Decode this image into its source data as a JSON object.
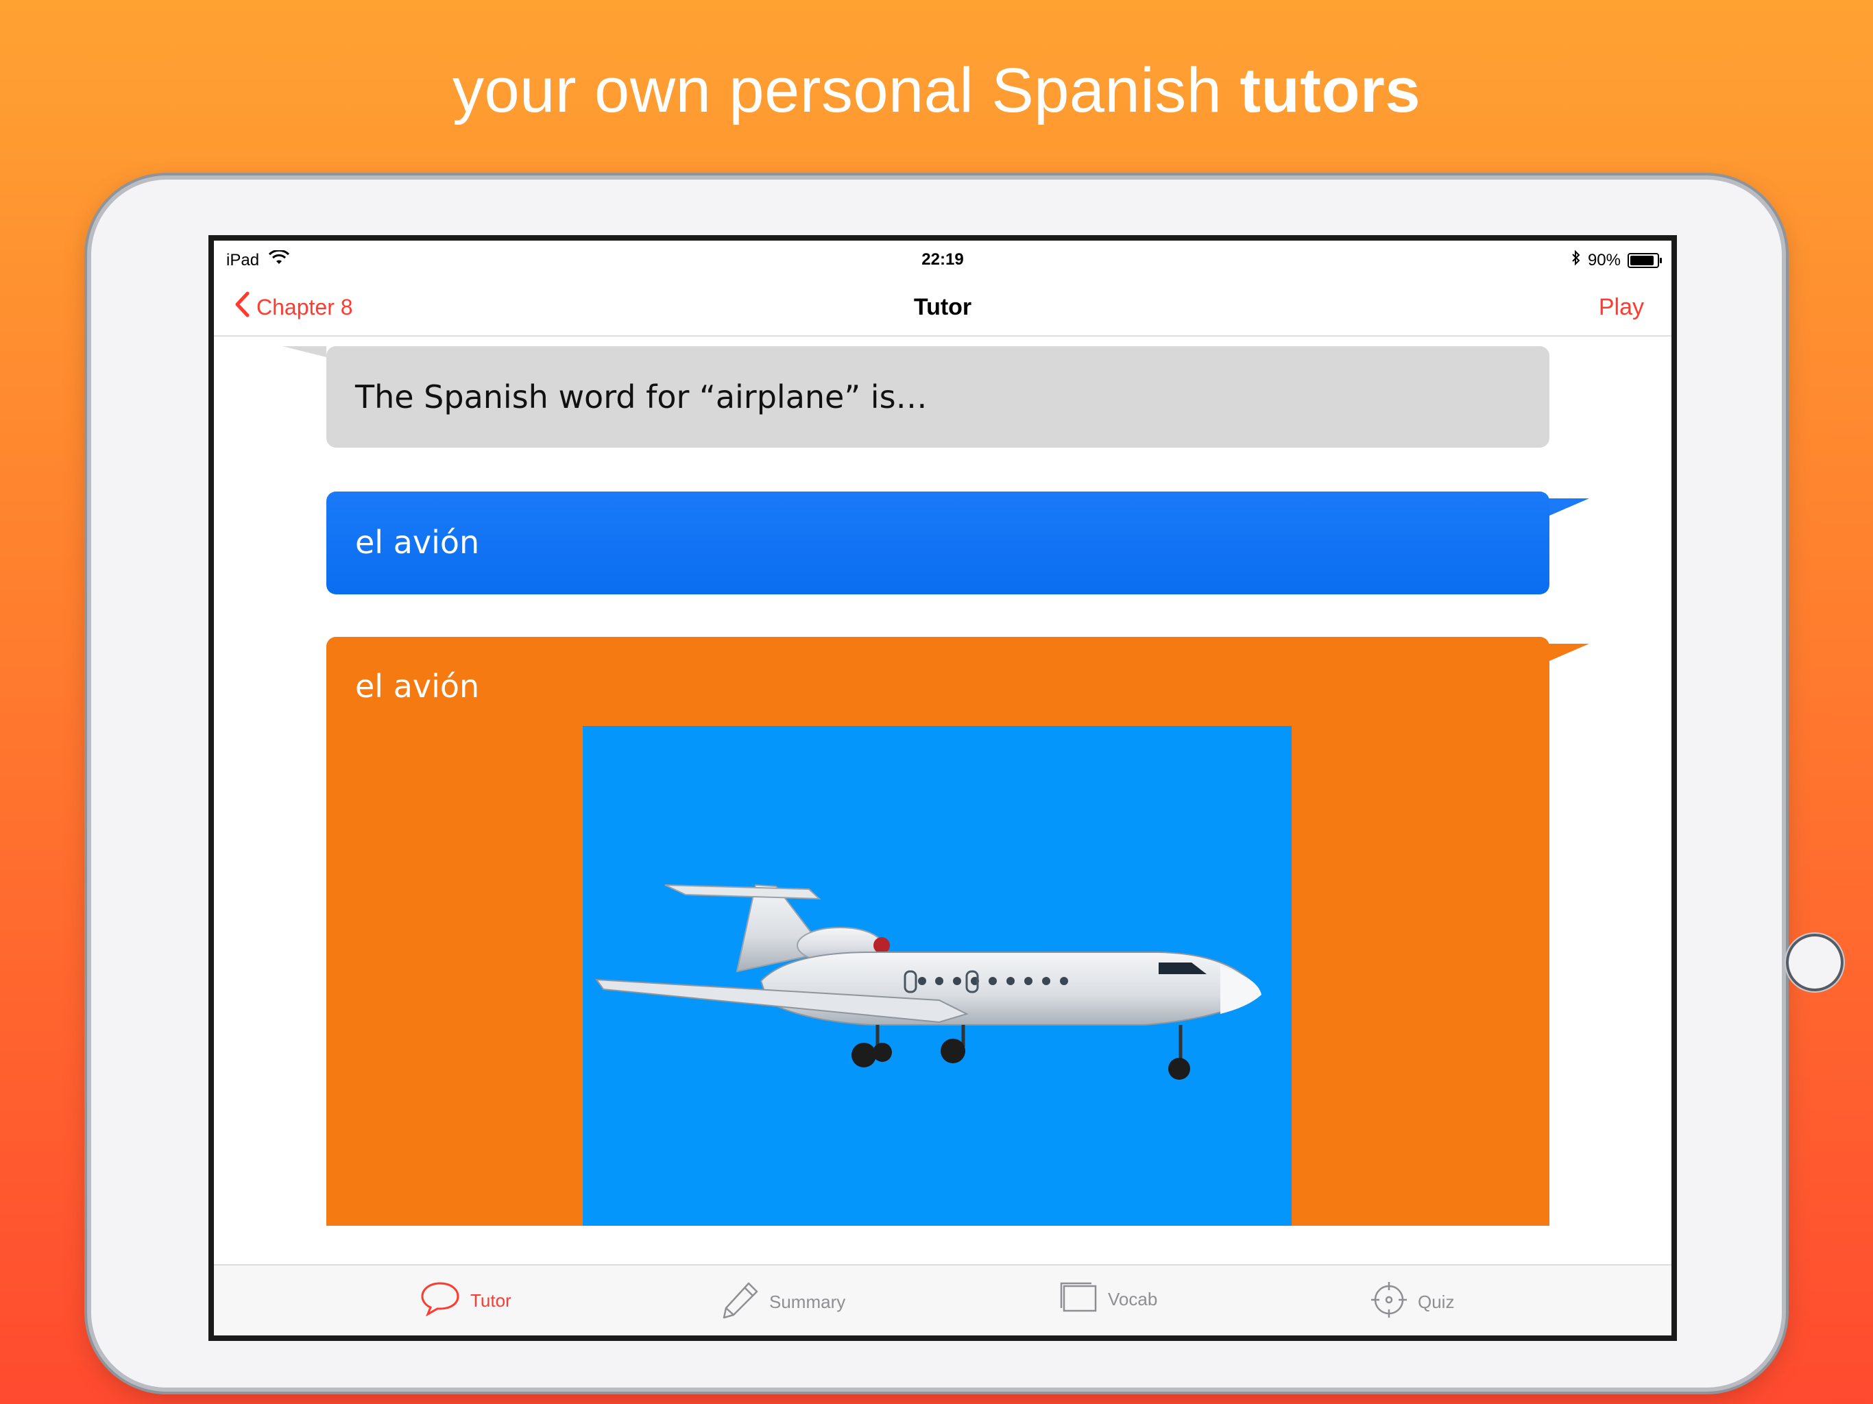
{
  "marketing": {
    "headline_regular": "your own personal Spanish ",
    "headline_bold": "tutors"
  },
  "statusbar": {
    "device": "iPad",
    "time": "22:19",
    "battery_percent": "90%",
    "battery_level": 0.9
  },
  "navbar": {
    "back_label": "Chapter 8",
    "title": "Tutor",
    "action_label": "Play"
  },
  "chat": {
    "prompt_text": "The Spanish word for “airplane” is…",
    "answer_text": "el avión",
    "card_text": "el avión"
  },
  "tabs": [
    {
      "label": "Tutor",
      "icon": "speech-bubble-icon",
      "active": true
    },
    {
      "label": "Summary",
      "icon": "pencil-icon",
      "active": false
    },
    {
      "label": "Vocab",
      "icon": "cards-icon",
      "active": false
    },
    {
      "label": "Quiz",
      "icon": "target-icon",
      "active": false
    }
  ],
  "colors": {
    "accent": "#ff3b30",
    "prompt_bubble": "#d8d8d8",
    "answer_bubble": "#0a6ef0",
    "card_bubble": "#f47a11",
    "image_sky": "#0596fb"
  }
}
